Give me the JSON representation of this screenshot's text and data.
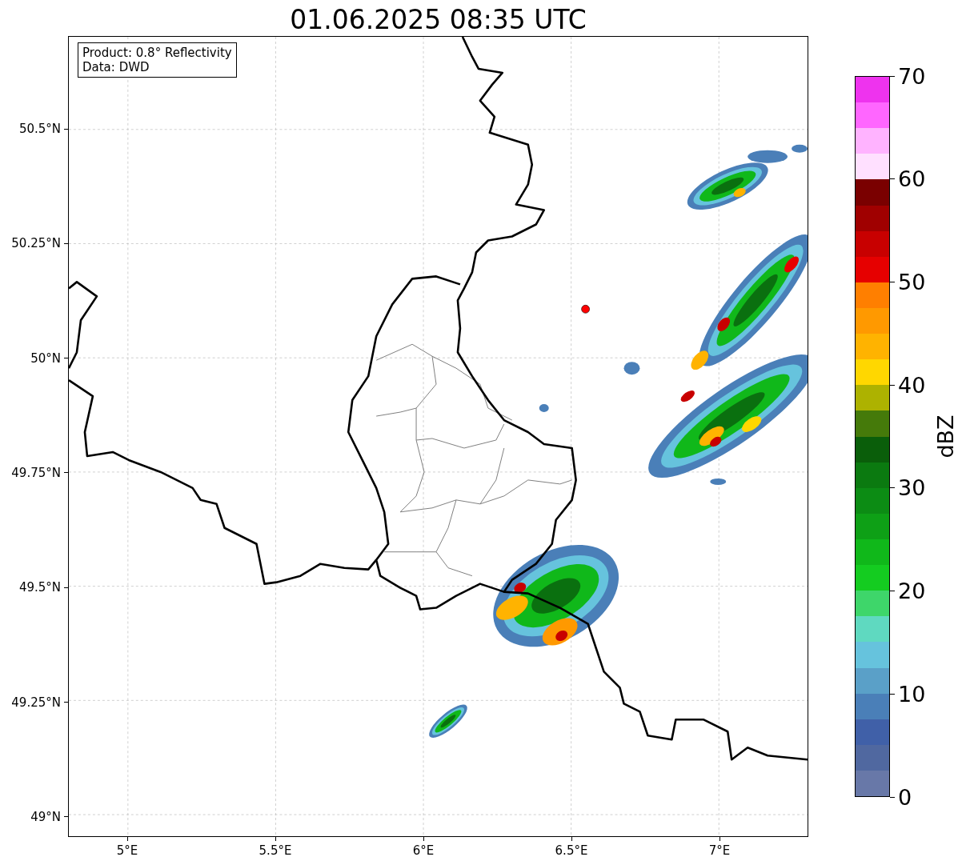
{
  "title": "01.06.2025 08:35 UTC",
  "legend": {
    "lines": [
      "Product: 0.8° Reflectivity",
      "Data: DWD"
    ]
  },
  "map": {
    "lat_ticks": [
      "50.5°N",
      "50.25°N",
      "50°N",
      "49.75°N",
      "49.5°N",
      "49.25°N",
      "49°N"
    ],
    "lon_ticks": [
      "5°E",
      "5.5°E",
      "6°E",
      "6.5°E",
      "7°E"
    ]
  },
  "colorbar": {
    "label": "dBZ",
    "ticks": [
      "70",
      "60",
      "50",
      "40",
      "30",
      "20",
      "10",
      "0"
    ],
    "segments": [
      {
        "color": "#ee33ee"
      },
      {
        "color": "#ff66ff"
      },
      {
        "color": "#ffb3ff"
      },
      {
        "color": "#ffe0ff"
      },
      {
        "color": "#7a0000"
      },
      {
        "color": "#a00000"
      },
      {
        "color": "#c80000"
      },
      {
        "color": "#e60000"
      },
      {
        "color": "#ff7f00"
      },
      {
        "color": "#ff9900"
      },
      {
        "color": "#ffb300"
      },
      {
        "color": "#ffd700"
      },
      {
        "color": "#adb200"
      },
      {
        "color": "#457a0a"
      },
      {
        "color": "#0a5e0a"
      },
      {
        "color": "#0b7a10"
      },
      {
        "color": "#0c8c14"
      },
      {
        "color": "#0ea016"
      },
      {
        "color": "#10b81a"
      },
      {
        "color": "#14cc20"
      },
      {
        "color": "#3ed66a"
      },
      {
        "color": "#5fd9c0"
      },
      {
        "color": "#66c3dd"
      },
      {
        "color": "#5aa0c8"
      },
      {
        "color": "#4a7fb8"
      },
      {
        "color": "#4060a8"
      },
      {
        "color": "#5068a0"
      },
      {
        "color": "#6878a8"
      }
    ]
  }
}
